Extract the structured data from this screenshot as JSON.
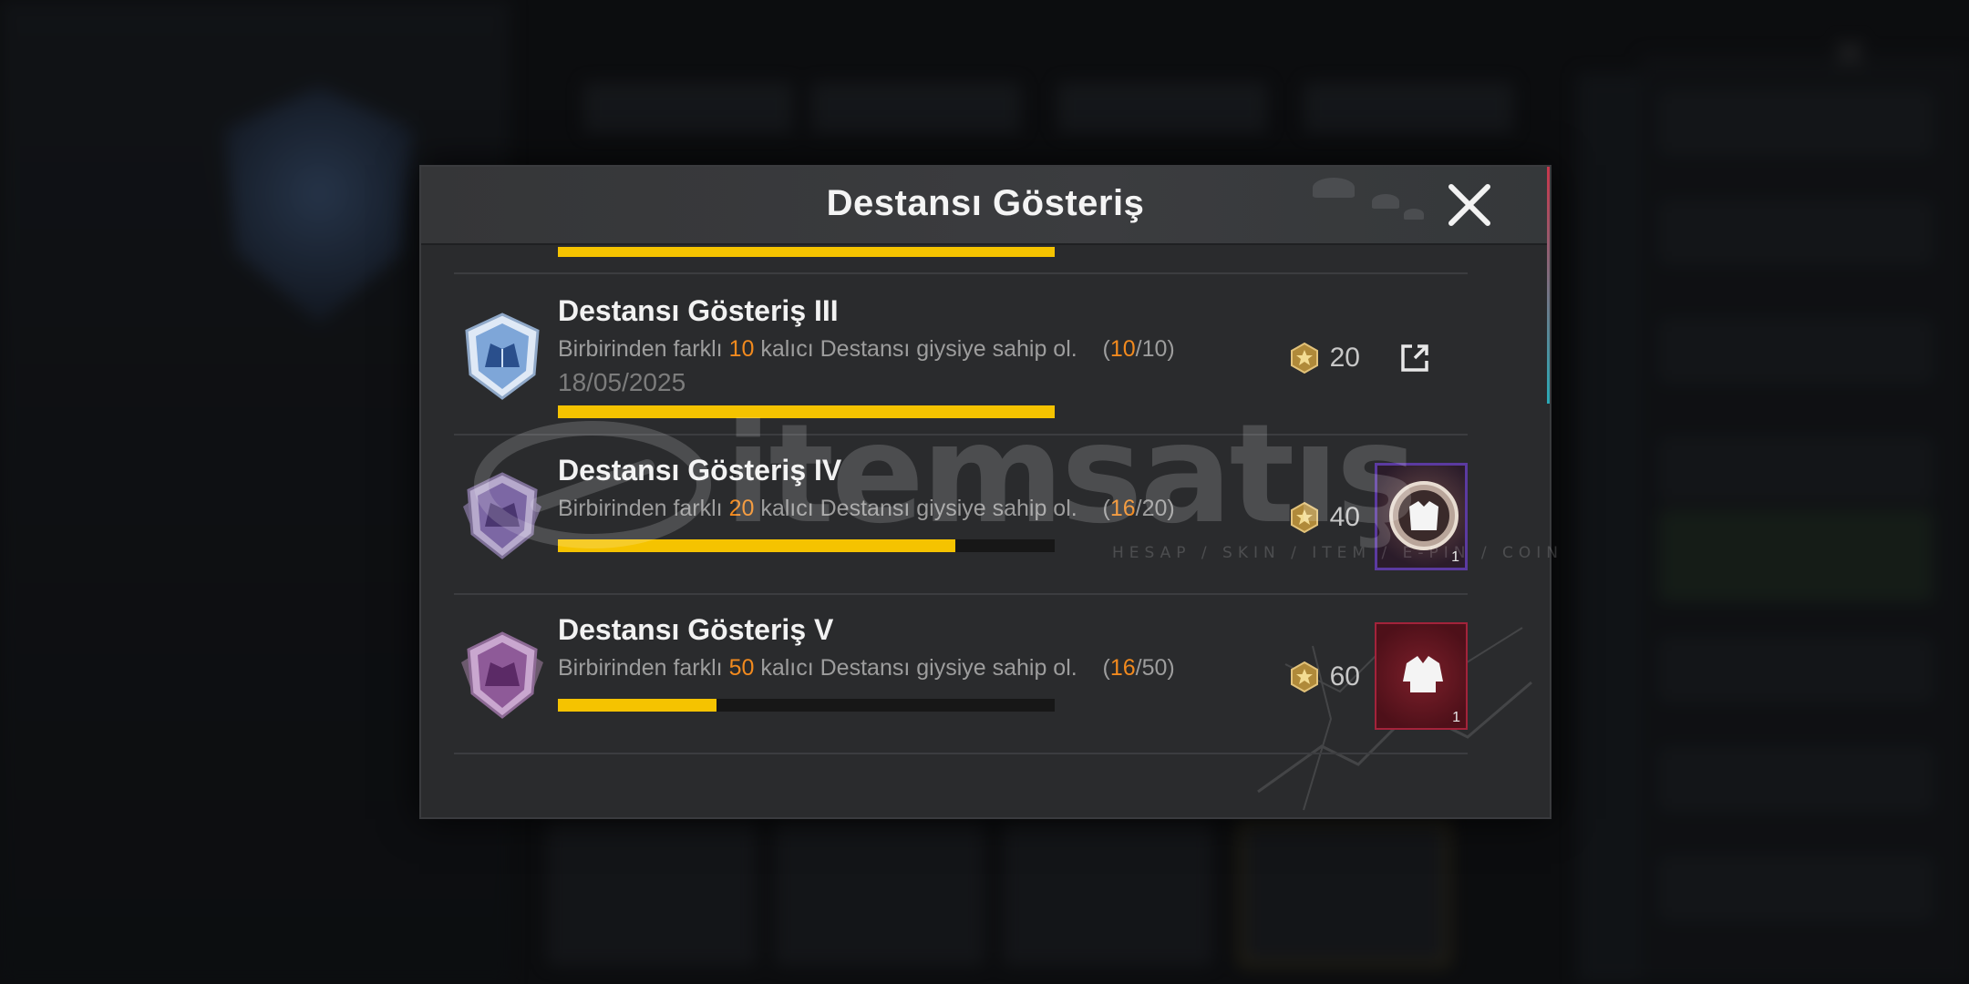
{
  "dialog": {
    "title": "Destansı Gösteriş"
  },
  "achievements": [
    {
      "title": "Destansı Gösteriş III",
      "desc_prefix": "Birbirinden farklı ",
      "desc_target": "10",
      "desc_suffix": " kalıcı Destansı giysiye sahip ol.",
      "count_open": "(",
      "count_current": "10",
      "count_total": "/10)",
      "date": "18/05/2025",
      "progress": 1.0,
      "reward": "20",
      "badge_color": "#9fc3ea"
    },
    {
      "title": "Destansı Gösteriş IV",
      "desc_prefix": "Birbirinden farklı ",
      "desc_target": "20",
      "desc_suffix": " kalıcı Destansı giysiye sahip ol.",
      "count_open": "(",
      "count_current": "16",
      "count_total": "/20)",
      "progress": 0.8,
      "reward": "40",
      "item_count": "1",
      "badge_color": "#8f7bb0"
    },
    {
      "title": "Destansı Gösteriş V",
      "desc_prefix": "Birbirinden farklı ",
      "desc_target": "50",
      "desc_suffix": " kalıcı Destansı giysiye sahip ol.",
      "count_open": "(",
      "count_current": "16",
      "count_total": "/50)",
      "progress": 0.32,
      "reward": "60",
      "item_count": "1",
      "badge_color": "#9b6fa4"
    }
  ],
  "watermark": {
    "brand": "itemsatış",
    "tagline": "HESAP / SKIN / ITEM / E-PIN / COIN"
  },
  "colors": {
    "progress_fill": "#f5c300",
    "highlight": "#f28a1e",
    "dialog_bg": "#2a2b2d"
  }
}
